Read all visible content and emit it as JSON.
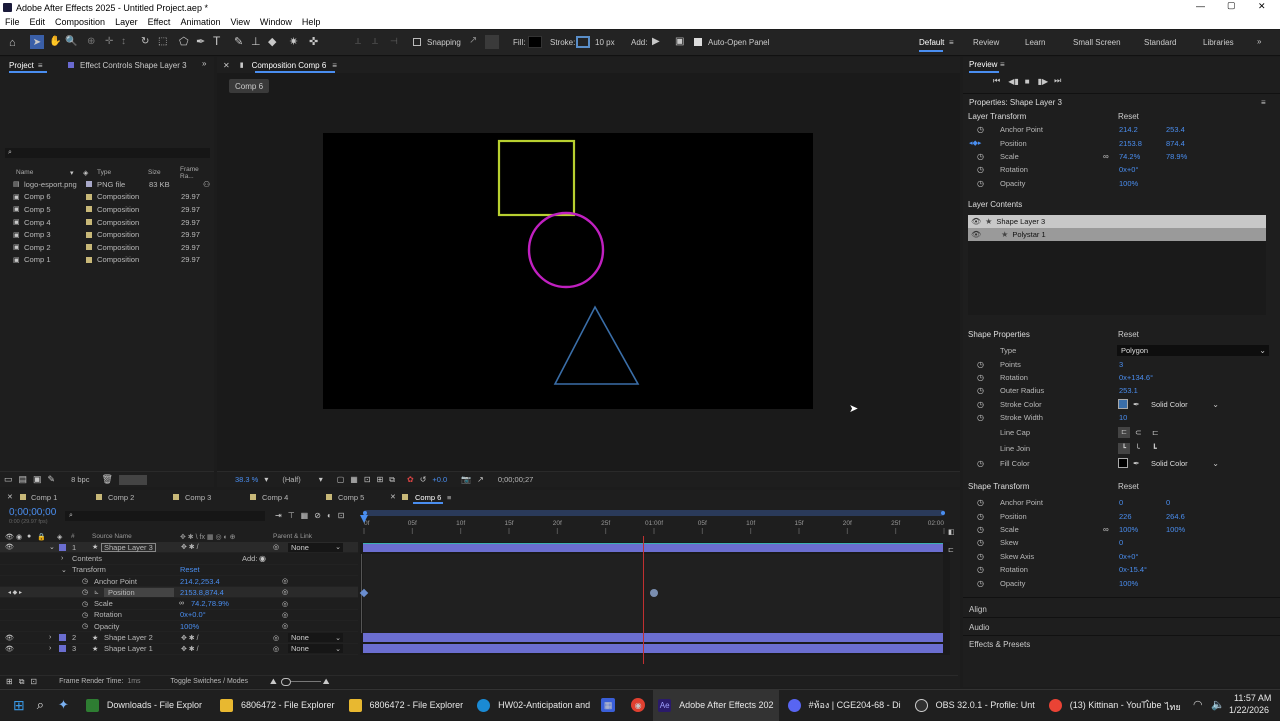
{
  "title": "Adobe After Effects 2025 - Untitled Project.aep *",
  "window_controls": {
    "min": "—",
    "max": "▢",
    "close": "✕"
  },
  "menu": [
    "File",
    "Edit",
    "Composition",
    "Layer",
    "Effect",
    "Animation",
    "View",
    "Window",
    "Help"
  ],
  "toolbar": {
    "snapping": "Snapping",
    "fill": "Fill:",
    "stroke": "Stroke:",
    "stroke_px": "10 px",
    "add": "Add:",
    "auto_open": "Auto-Open Panel"
  },
  "workspaces": [
    "Default",
    "Review",
    "Learn",
    "Small Screen",
    "Standard",
    "Libraries"
  ],
  "project": {
    "tab_project": "Project",
    "tab_effect": "Effect Controls Shape Layer 3",
    "search_placeholder": "",
    "columns": {
      "name": "Name",
      "type": "Type",
      "size": "Size",
      "frame": "Frame Ra..."
    },
    "items": [
      {
        "name": "logo-esport.png",
        "type": "PNG file",
        "size": "83 KB",
        "frame": ""
      },
      {
        "name": "Comp 6",
        "type": "Composition",
        "size": "",
        "frame": "29.97"
      },
      {
        "name": "Comp 5",
        "type": "Composition",
        "size": "",
        "frame": "29.97"
      },
      {
        "name": "Comp 4",
        "type": "Composition",
        "size": "",
        "frame": "29.97"
      },
      {
        "name": "Comp 3",
        "type": "Composition",
        "size": "",
        "frame": "29.97"
      },
      {
        "name": "Comp 2",
        "type": "Composition",
        "size": "",
        "frame": "29.97"
      },
      {
        "name": "Comp 1",
        "type": "Composition",
        "size": "",
        "frame": "29.97"
      }
    ],
    "bpc": "8 bpc"
  },
  "comp": {
    "tab": "Composition Comp 6",
    "sub_tab": "Comp 6",
    "zoom": "38.3 %",
    "res": "(Half)",
    "exposure": "+0.0",
    "timecode": "0;00;00;27"
  },
  "preview": {
    "title": "Preview"
  },
  "properties": {
    "title": "Properties: Shape Layer 3",
    "layer_transform": {
      "title": "Layer Transform",
      "reset": "Reset",
      "rows": [
        {
          "label": "Anchor Point",
          "v1": "214.2",
          "v2": "253.4"
        },
        {
          "label": "Position",
          "v1": "2153.8",
          "v2": "874.4"
        },
        {
          "label": "Scale",
          "v1": "74.2%",
          "v2": "78.9%"
        },
        {
          "label": "Rotation",
          "v1": "0x+0°",
          "v2": ""
        },
        {
          "label": "Opacity",
          "v1": "100%",
          "v2": ""
        }
      ]
    },
    "layer_contents": {
      "title": "Layer Contents",
      "items": [
        "Shape Layer 3",
        "Polystar 1"
      ]
    },
    "shape_properties": {
      "title": "Shape Properties",
      "reset": "Reset",
      "rows": [
        {
          "label": "Type",
          "value": "Polygon"
        },
        {
          "label": "Points",
          "value": "3"
        },
        {
          "label": "Rotation",
          "value": "0x+134.6°"
        },
        {
          "label": "Outer Radius",
          "value": "253.1"
        },
        {
          "label": "Stroke Color",
          "value": "Solid Color"
        },
        {
          "label": "Stroke Width",
          "value": "10"
        },
        {
          "label": "Line Cap",
          "value": ""
        },
        {
          "label": "Line Join",
          "value": ""
        },
        {
          "label": "Fill Color",
          "value": "Solid Color"
        }
      ]
    },
    "shape_transform": {
      "title": "Shape Transform",
      "reset": "Reset",
      "rows": [
        {
          "label": "Anchor Point",
          "v1": "0",
          "v2": "0"
        },
        {
          "label": "Position",
          "v1": "226",
          "v2": "264.6"
        },
        {
          "label": "Scale",
          "v1": "100%",
          "v2": "100%"
        },
        {
          "label": "Skew",
          "v1": "0",
          "v2": ""
        },
        {
          "label": "Skew Axis",
          "v1": "0x+0°",
          "v2": ""
        },
        {
          "label": "Rotation",
          "v1": "0x-15.4°",
          "v2": ""
        },
        {
          "label": "Opacity",
          "v1": "100%",
          "v2": ""
        }
      ]
    },
    "sections": [
      "Align",
      "Audio",
      "Effects & Presets"
    ]
  },
  "timeline": {
    "tabs": [
      "Comp 1",
      "Comp 2",
      "Comp 3",
      "Comp 4",
      "Comp 5",
      "Comp 6"
    ],
    "timecode": "0;00;00;00",
    "fps": "0:00 (29.97 fps)",
    "search_placeholder": "",
    "cols": {
      "num": "#",
      "source": "Source Name",
      "parent": "Parent & Link"
    },
    "ruler": [
      "0f",
      "05f",
      "10f",
      "15f",
      "20f",
      "25f",
      "01:00f",
      "05f",
      "10f",
      "15f",
      "20f",
      "25f",
      "02:00"
    ],
    "layer3": {
      "num": "1",
      "name": "Shape Layer 3",
      "parent": "None"
    },
    "contents": "Contents",
    "add": "Add:",
    "transform": "Transform",
    "reset": "Reset",
    "props": [
      {
        "label": "Anchor Point",
        "value": "214.2,253.4"
      },
      {
        "label": "Position",
        "value": "2153.8,874.4"
      },
      {
        "label": "Scale",
        "value": "74.2,78.9%"
      },
      {
        "label": "Rotation",
        "value": "0x+0.0°"
      },
      {
        "label": "Opacity",
        "value": "100%"
      }
    ],
    "layer2": {
      "num": "2",
      "name": "Shape Layer 2",
      "parent": "None"
    },
    "layer1": {
      "num": "3",
      "name": "Shape Layer 1",
      "parent": "None"
    },
    "footer_render": "Frame Render Time: ",
    "footer_ms": "1ms",
    "footer_toggle": "Toggle Switches / Modes"
  },
  "taskbar": {
    "items": [
      {
        "label": "Downloads - File Explor",
        "color": "#2e7d32"
      },
      {
        "label": "6806472 - File Explorer",
        "color": "#e8b830"
      },
      {
        "label": "6806472 - File Explorer",
        "color": "#e8b830"
      },
      {
        "label": "HW02-Anticipation and",
        "color": "#1a8ad4"
      },
      {
        "label": "Adobe After Effects 202",
        "color": "#2a1a6a"
      },
      {
        "label": "#ห้อง | CGE204-68 - Di",
        "color": "#5865f2"
      },
      {
        "label": "OBS 32.0.1 - Profile: Unt",
        "color": "#303030"
      },
      {
        "label": "(13) Kittinan - YouTube",
        "color": "#ea4335"
      }
    ],
    "lang": "ไทย",
    "time": "11:57 AM",
    "date": "1/22/2026"
  },
  "colors": {
    "accent": "#4a8ef0",
    "layer_bar": "#6b6ed0",
    "square": "#b8d030",
    "circle": "#c020c0",
    "triangle": "#3a6ea8"
  }
}
